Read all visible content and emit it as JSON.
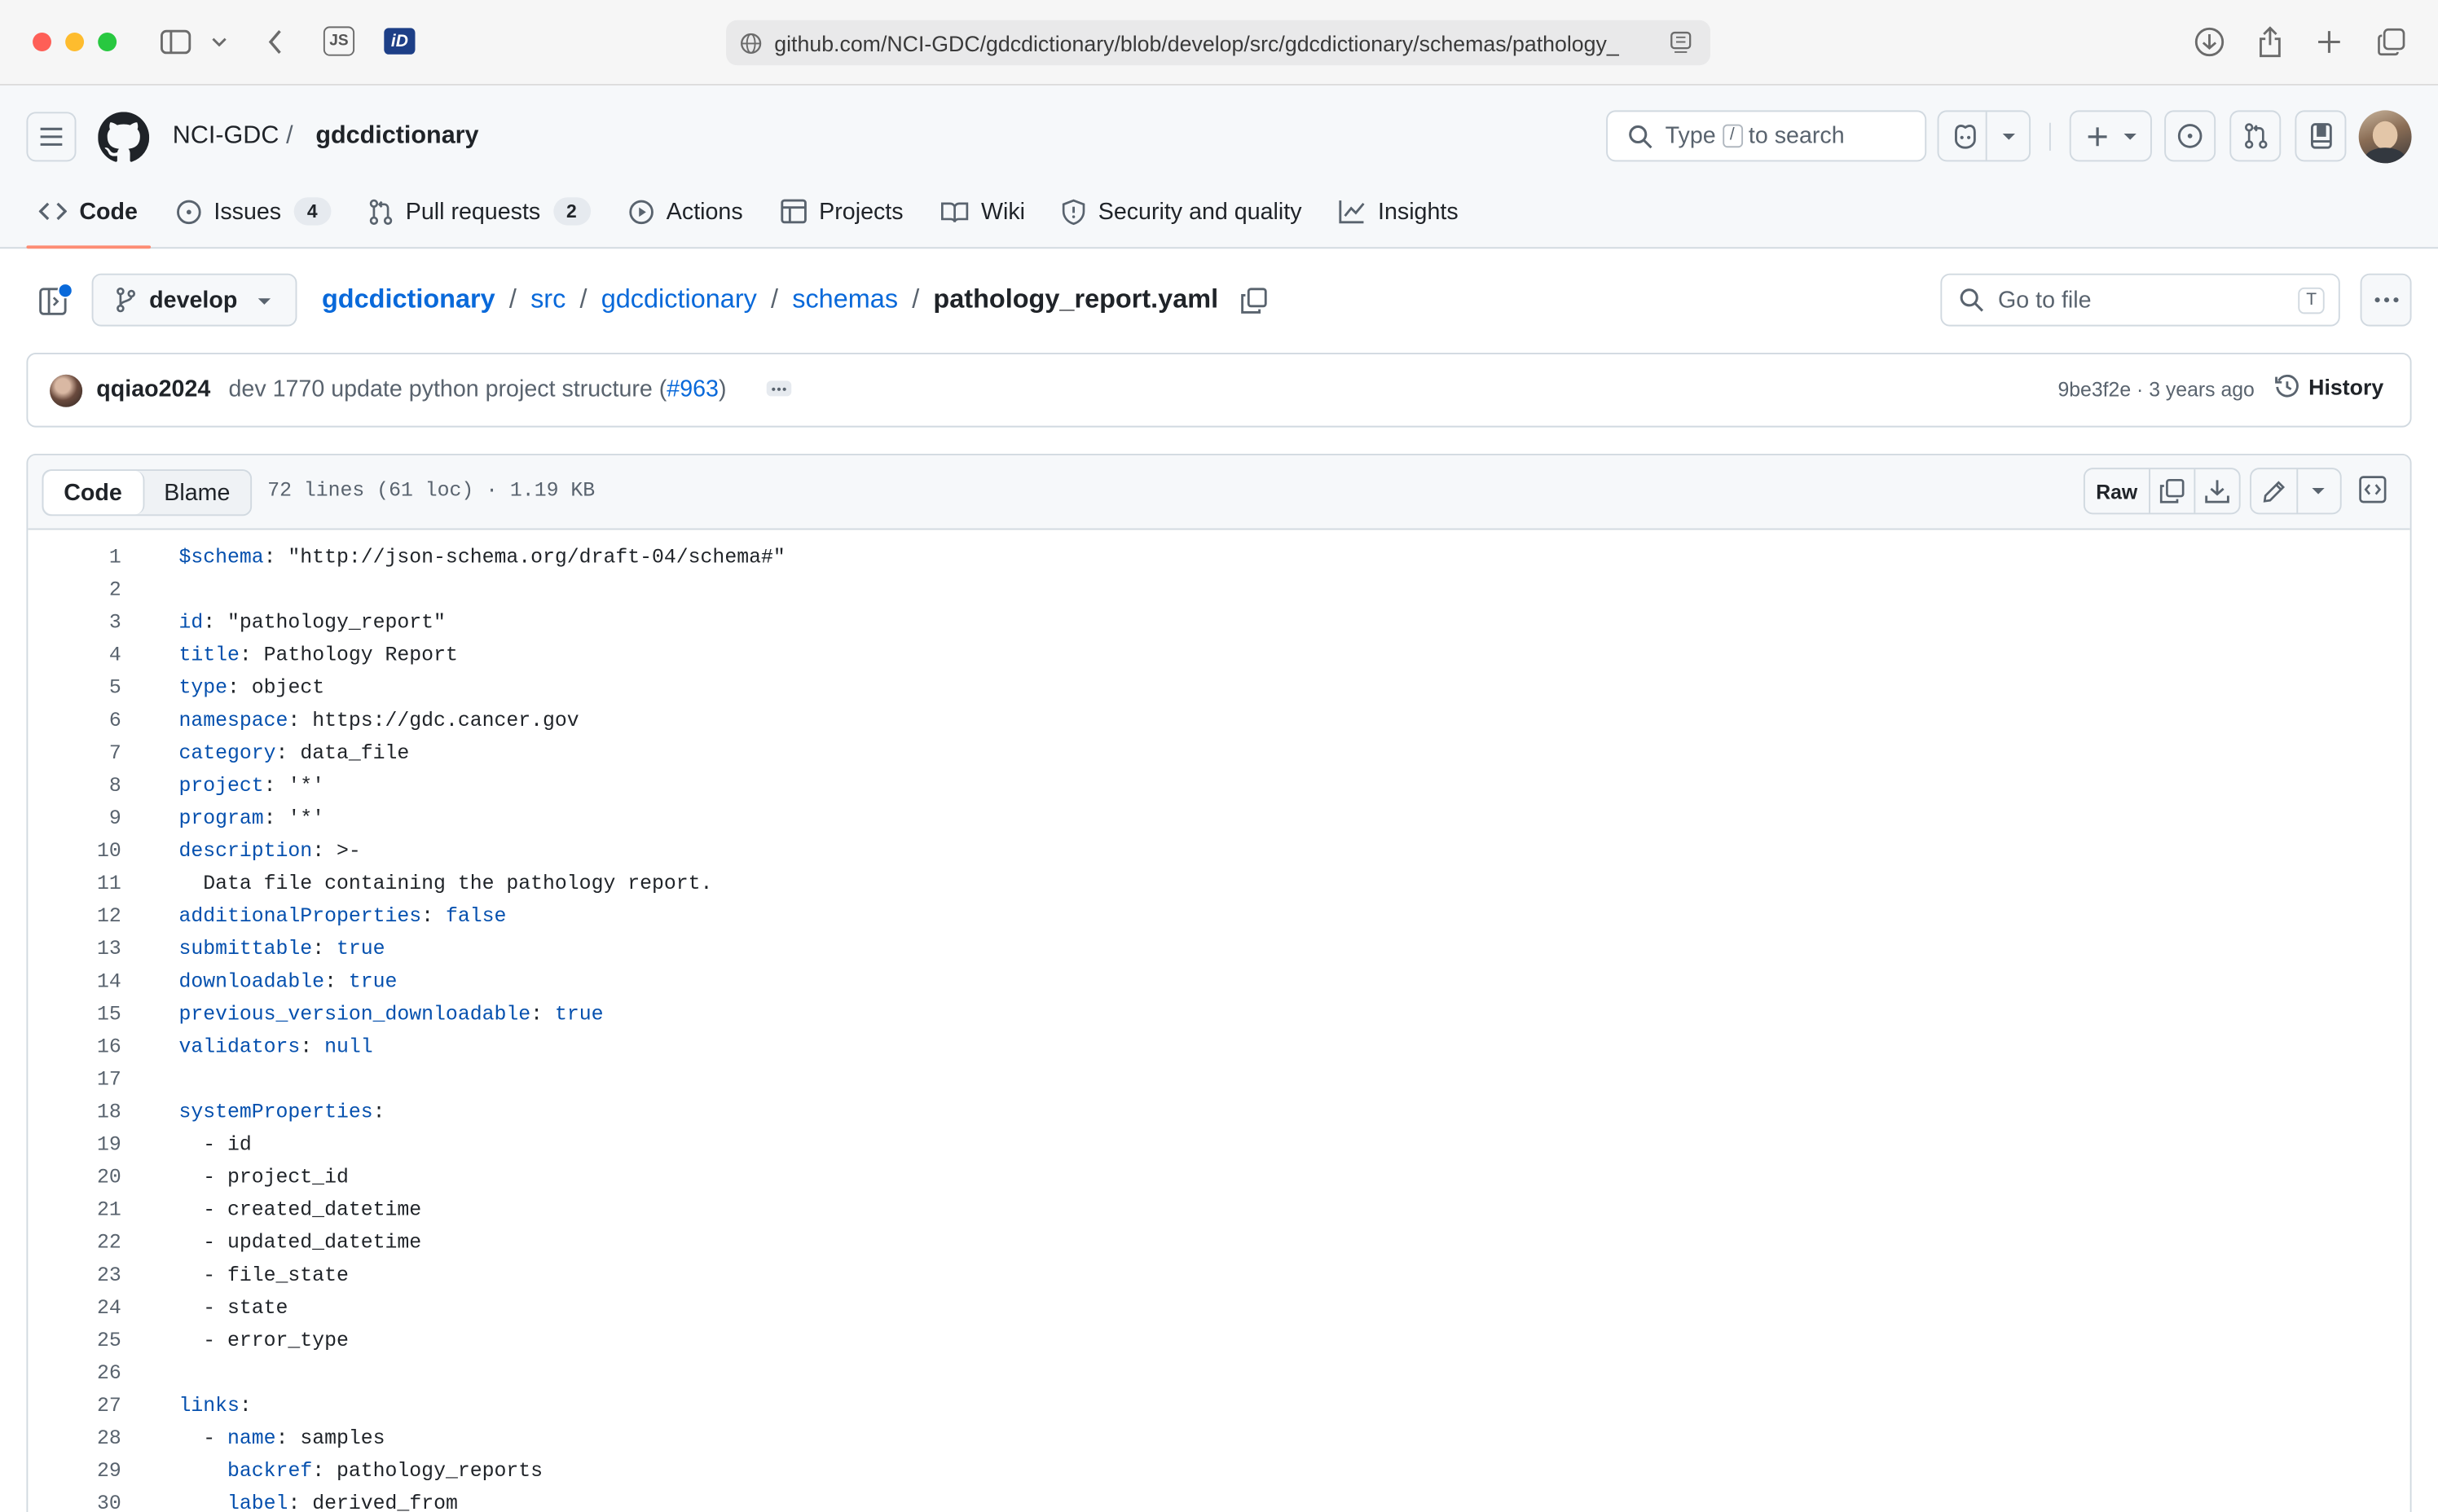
{
  "browser": {
    "url": "github.com/NCI-GDC/gdcdictionary/blob/develop/src/gdcdictionary/schemas/pathology_",
    "js_label": "JS",
    "id_label": "iD"
  },
  "header": {
    "owner": "NCI-GDC",
    "repo": "gdcdictionary",
    "search_type": "Type",
    "search_key": "/",
    "search_rest": "to search"
  },
  "tabs": [
    {
      "label": "Code"
    },
    {
      "label": "Issues",
      "count": "4"
    },
    {
      "label": "Pull requests",
      "count": "2"
    },
    {
      "label": "Actions"
    },
    {
      "label": "Projects"
    },
    {
      "label": "Wiki"
    },
    {
      "label": "Security and quality"
    },
    {
      "label": "Insights"
    }
  ],
  "filenav": {
    "branch": "develop",
    "crumbs": [
      "gdcdictionary",
      "src",
      "gdcdictionary",
      "schemas"
    ],
    "filename": "pathology_report.yaml",
    "goto_placeholder": "Go to file",
    "goto_key": "T"
  },
  "commit": {
    "author": "qqiao2024",
    "message": "dev 1770 update python project structure (",
    "pr": "#963",
    "message_end": ")",
    "hash": "9be3f2e",
    "age": "· 3 years ago",
    "history_label": "History"
  },
  "file": {
    "view_code": "Code",
    "view_blame": "Blame",
    "info": "72 lines (61 loc) · 1.19 KB",
    "raw_label": "Raw"
  },
  "lines": [
    {
      "n": "1",
      "k": "$schema",
      "v": ": \"http://json-schema.org/draft-04/schema#\""
    },
    {
      "n": "2",
      "k": "",
      "v": ""
    },
    {
      "n": "3",
      "k": "id",
      "v": ": \"pathology_report\""
    },
    {
      "n": "4",
      "k": "title",
      "v": ": Pathology Report"
    },
    {
      "n": "5",
      "k": "type",
      "v": ": object"
    },
    {
      "n": "6",
      "k": "namespace",
      "v": ": https://gdc.cancer.gov"
    },
    {
      "n": "7",
      "k": "category",
      "v": ": data_file"
    },
    {
      "n": "8",
      "k": "project",
      "v": ": '*'"
    },
    {
      "n": "9",
      "k": "program",
      "v": ": '*'"
    },
    {
      "n": "10",
      "k": "description",
      "v": ": >-"
    },
    {
      "n": "11",
      "k": "",
      "v": "  Data file containing the pathology report."
    },
    {
      "n": "12",
      "k": "additionalProperties",
      "v": ": ",
      "b": "false"
    },
    {
      "n": "13",
      "k": "submittable",
      "v": ": ",
      "b": "true"
    },
    {
      "n": "14",
      "k": "downloadable",
      "v": ": ",
      "b": "true"
    },
    {
      "n": "15",
      "k": "previous_version_downloadable",
      "v": ": ",
      "b": "true"
    },
    {
      "n": "16",
      "k": "validators",
      "v": ": ",
      "b": "null"
    },
    {
      "n": "17",
      "k": "",
      "v": ""
    },
    {
      "n": "18",
      "k": "systemProperties",
      "v": ":"
    },
    {
      "n": "19",
      "k": "",
      "v": "  - id"
    },
    {
      "n": "20",
      "k": "",
      "v": "  - project_id"
    },
    {
      "n": "21",
      "k": "",
      "v": "  - created_datetime"
    },
    {
      "n": "22",
      "k": "",
      "v": "  - updated_datetime"
    },
    {
      "n": "23",
      "k": "",
      "v": "  - file_state"
    },
    {
      "n": "24",
      "k": "",
      "v": "  - state"
    },
    {
      "n": "25",
      "k": "",
      "v": "  - error_type"
    },
    {
      "n": "26",
      "k": "",
      "v": ""
    },
    {
      "n": "27",
      "k": "links",
      "v": ":"
    },
    {
      "n": "28",
      "p": "  - ",
      "k": "name",
      "v": ": samples"
    },
    {
      "n": "29",
      "p": "    ",
      "k": "backref",
      "v": ": pathology_reports"
    },
    {
      "n": "30",
      "p": "    ",
      "k": "label",
      "v": ": derived_from"
    }
  ]
}
